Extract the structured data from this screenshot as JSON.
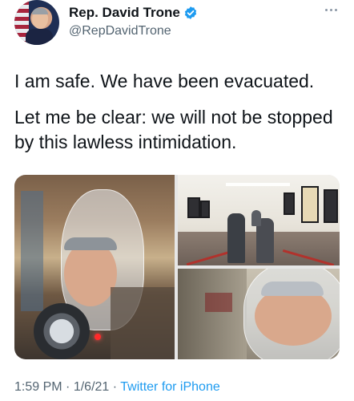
{
  "author": {
    "display_name": "Rep. David Trone",
    "handle": "@RepDavidTrone",
    "verified": true,
    "avatar_icon": "profile-photo"
  },
  "tweet": {
    "paragraphs": [
      "I am safe. We have been evacuated.",
      "Let me be clear: we will not be stopped by this lawless intimidation."
    ]
  },
  "media": {
    "count": 3
  },
  "footer": {
    "time": "1:59 PM",
    "separator1": "·",
    "date": "1/6/21",
    "separator2": "·",
    "source": "Twitter for iPhone"
  },
  "colors": {
    "link": "#1d9bf0",
    "secondary": "#536471",
    "verified": "#1d9bf0"
  },
  "icons": {
    "verified": "verified-badge-icon",
    "more": "more-options-icon"
  }
}
